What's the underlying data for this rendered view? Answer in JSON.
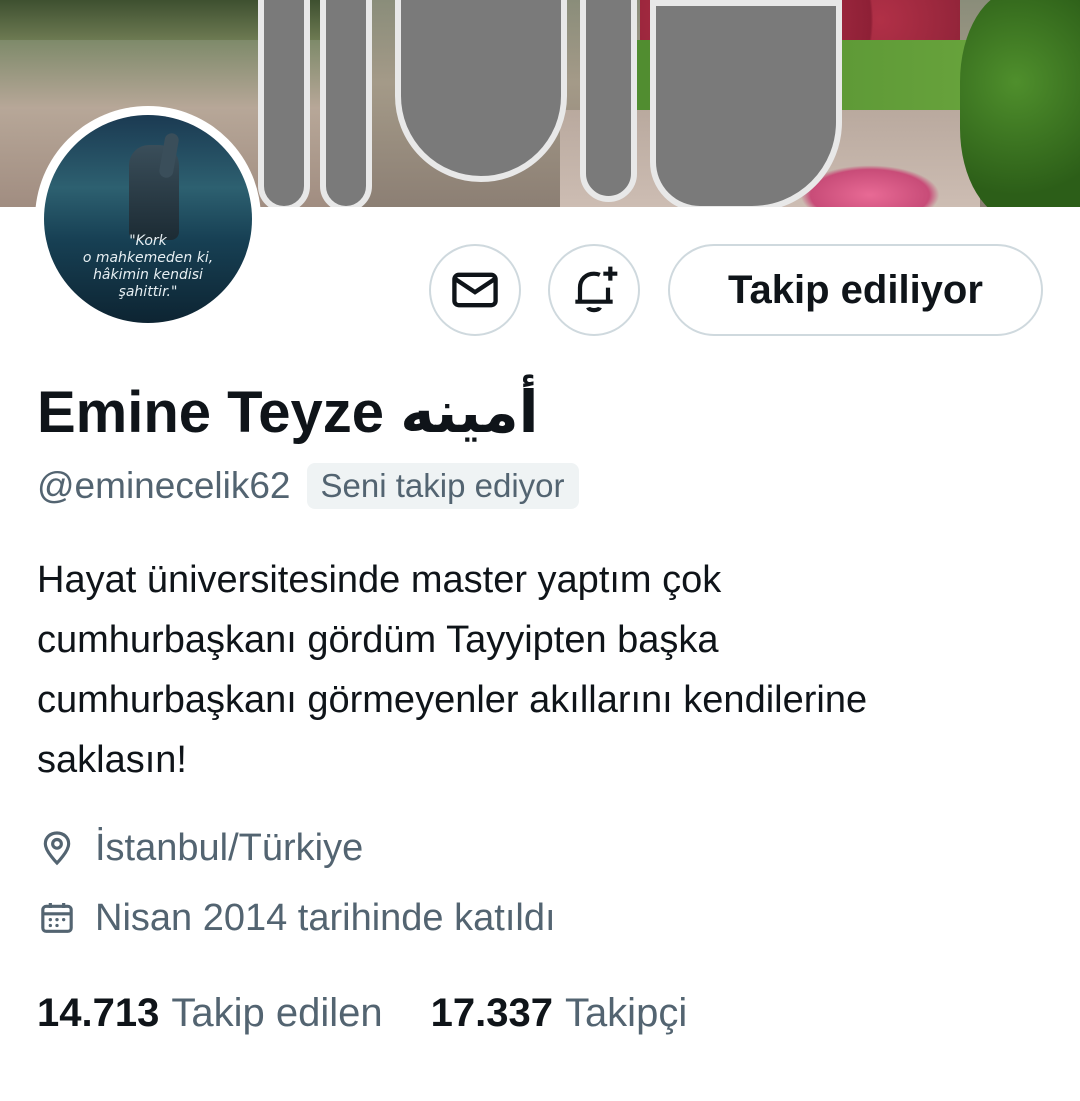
{
  "profile": {
    "display_name": "Emine Teyze أمينه",
    "handle": "@eminecelik62",
    "follows_you_badge": "Seni takip ediyor",
    "bio": "Hayat üniversitesinde master yaptım çok\ncumhurbaşkanı gördüm Tayyipten başka\ncumhurbaşkanı görmeyenler akıllarını kendilerine\nsaklasın!",
    "avatar_quote": "\"Kork\no mahkemeden ki,\nhâkimin kendisi\nşahittir.\"",
    "location": "İstanbul/Türkiye",
    "joined": "Nisan 2014 tarihinde katıldı"
  },
  "actions": {
    "message_icon": "envelope-icon",
    "notify_icon": "bell-plus-icon",
    "following_label": "Takip ediliyor"
  },
  "stats": {
    "following_count": "14.713",
    "following_label": "Takip edilen",
    "followers_count": "17.337",
    "followers_label": "Takipçi"
  },
  "colors": {
    "text_primary": "#0f1419",
    "text_secondary": "#536471",
    "border": "#cfd9de",
    "badge_bg": "#eff3f4"
  }
}
